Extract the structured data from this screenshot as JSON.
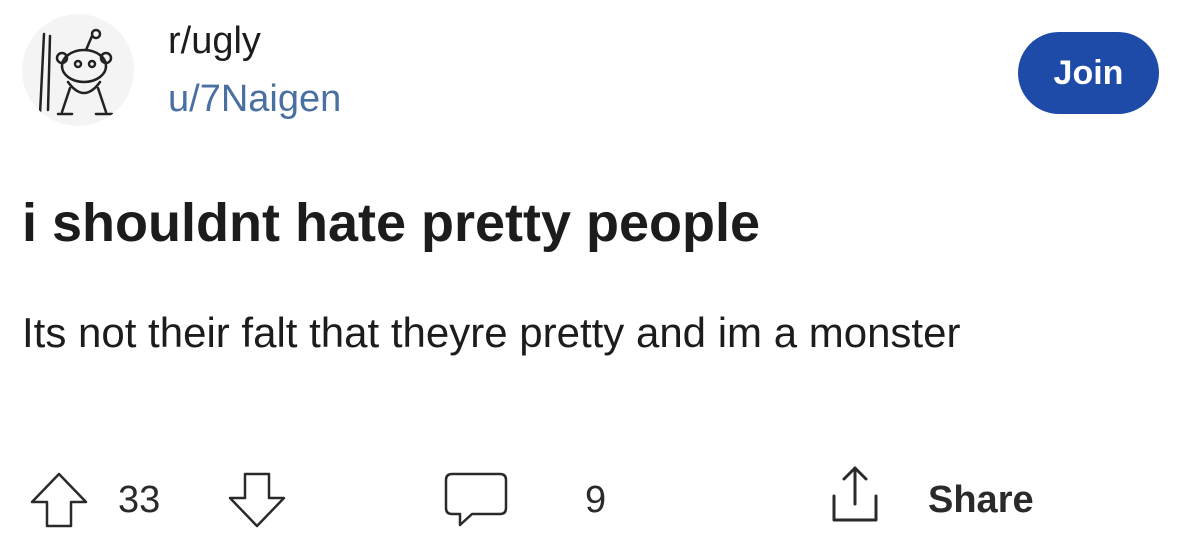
{
  "header": {
    "subreddit": "r/ugly",
    "username": "u/7Naigen",
    "avatar_icon": "snoo-avatar-icon",
    "join_label": "Join",
    "join_color": "#1e4aa8",
    "username_color": "#4a6fa1"
  },
  "post": {
    "title": "i shouldnt hate pretty people",
    "body": "Its not their falt that theyre pretty and im a monster"
  },
  "actions": {
    "upvote_icon": "upvote-arrow-icon",
    "vote_count": "33",
    "downvote_icon": "downvote-arrow-icon",
    "comment_icon": "comment-bubble-icon",
    "comment_count": "9",
    "share_icon": "share-icon",
    "share_label": "Share"
  }
}
